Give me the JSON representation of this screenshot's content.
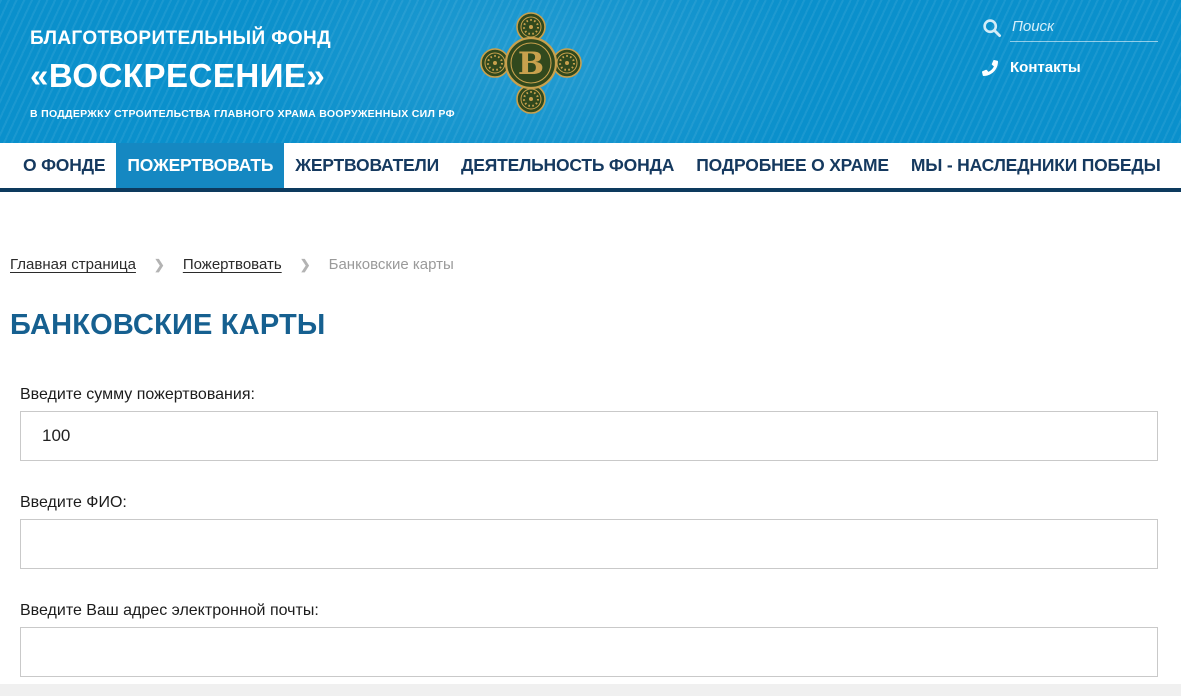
{
  "header": {
    "org_type": "БЛАГОТВОРИТЕЛЬНЫЙ ФОНД",
    "org_name": "«ВОСКРЕСЕНИЕ»",
    "tagline": "В ПОДДЕРЖКУ СТРОИТЕЛЬСТВА ГЛАВНОГО ХРАМА ВООРУЖЕННЫХ СИЛ РФ",
    "logo_letter": "В",
    "search": {
      "placeholder": "Поиск"
    },
    "contacts_label": "Контакты"
  },
  "nav": {
    "items": [
      {
        "label": "О ФОНДЕ",
        "active": false
      },
      {
        "label": "ПОЖЕРТВОВАТЬ",
        "active": true
      },
      {
        "label": "ЖЕРТВОВАТЕЛИ",
        "active": false
      },
      {
        "label": "ДЕЯТЕЛЬНОСТЬ ФОНДА",
        "active": false
      },
      {
        "label": "ПОДРОБНЕЕ О ХРАМЕ",
        "active": false
      },
      {
        "label": "МЫ - НАСЛЕДНИКИ ПОБЕДЫ",
        "active": false
      }
    ]
  },
  "breadcrumb": {
    "separator": "❯",
    "items": [
      {
        "label": "Главная страница"
      },
      {
        "label": "Пожертвовать"
      },
      {
        "label": "Банковские карты"
      }
    ]
  },
  "page": {
    "title": "БАНКОВСКИЕ КАРТЫ"
  },
  "form": {
    "fields": [
      {
        "label": "Введите сумму пожертвования:",
        "value": "100"
      },
      {
        "label": "Введите ФИО:",
        "value": ""
      },
      {
        "label": "Введите Ваш адрес электронной почты:",
        "value": ""
      }
    ]
  },
  "colors": {
    "header_bg": "#0a90cc",
    "nav_active_bg": "#1588c2",
    "nav_text": "#15395f",
    "nav_border": "#0d3a5e",
    "title_blue": "#166090",
    "emblem_gold": "#c8a14d",
    "emblem_green": "#31491d"
  }
}
